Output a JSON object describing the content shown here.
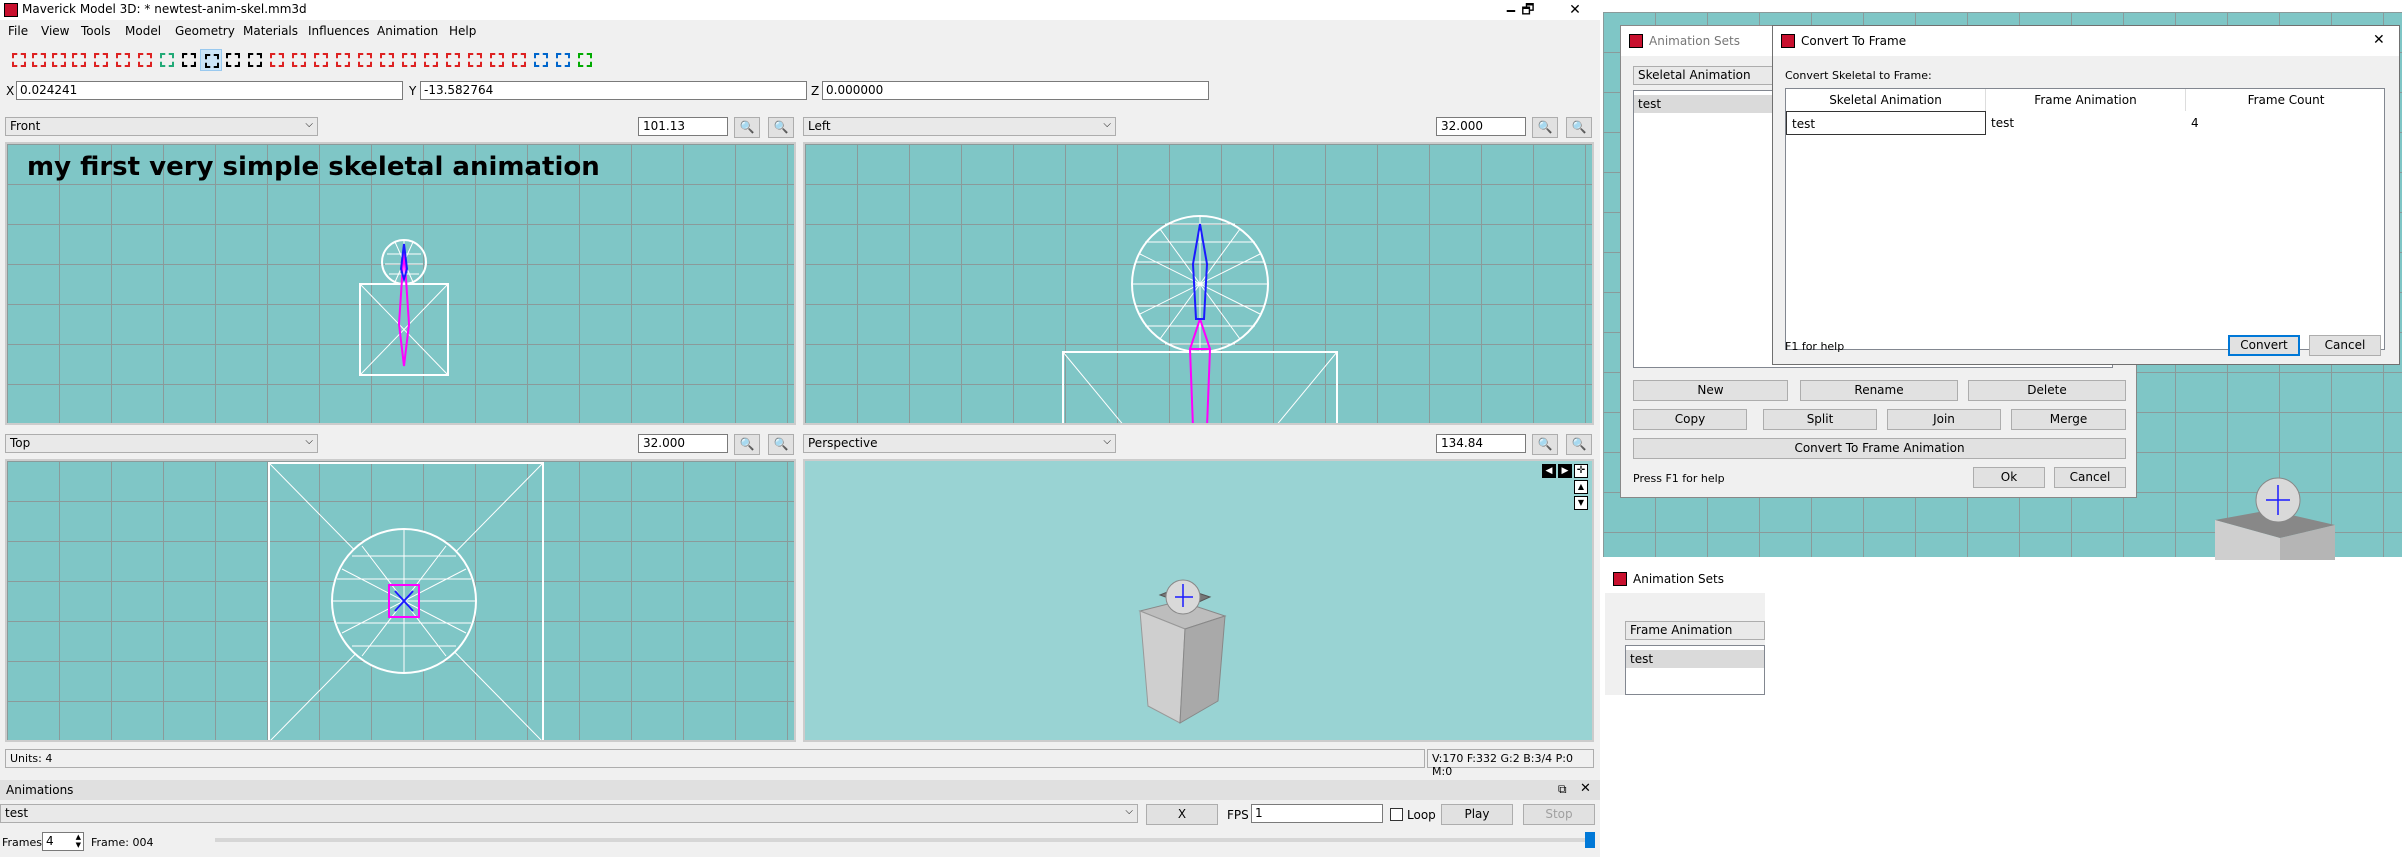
{
  "app": {
    "title": "Maverick Model 3D: * newtest-anim-skel.mm3d",
    "window_controls": [
      "🗕",
      "🗗",
      "✕"
    ]
  },
  "menu": [
    "File",
    "View",
    "Tools",
    "Model",
    "Geometry",
    "Materials",
    "Influences",
    "Animation",
    "Help"
  ],
  "toolbar": {
    "tools": [
      "select-vertices-icon",
      "select-faces-icon",
      "select-connected-icon",
      "select-groups-icon",
      "select-bone-joints-icon",
      "select-points-icon",
      "select-projections-icon",
      "attach-texture-icon",
      "move-icon",
      "rotate-icon",
      "scale-icon",
      "shear-icon",
      "create-vertex-icon",
      "create-bone-joint-icon",
      "create-point-icon",
      "create-projection-icon",
      "create-rectangle-icon",
      "create-cube-icon",
      "create-ellipsoid-icon",
      "create-cylinder-icon",
      "create-torus-icon",
      "create-polygon-icon",
      "background-grid-icon",
      "pan-icon",
      "view-icon",
      "extrude-icon",
      "cylinder-icon"
    ],
    "selected_index": 9
  },
  "coords": {
    "x_label": "X",
    "x_value": "0.024241",
    "y_label": "Y",
    "y_value": "-13.582764",
    "z_label": "Z",
    "z_value": "0.000000"
  },
  "viewports": {
    "front": {
      "view": "Front",
      "zoom": "101.13",
      "caption": "my first very simple skeletal animation"
    },
    "left": {
      "view": "Left",
      "zoom": "32.000"
    },
    "top": {
      "view": "Top",
      "zoom": "32.000"
    },
    "perspective": {
      "view": "Perspective",
      "zoom": "134.84"
    }
  },
  "status": {
    "units": "Units: 4",
    "stats": "V:170 F:332 G:2 B:3/4 P:0 M:0"
  },
  "animations_panel": {
    "title": "Animations",
    "selected_animation": "test",
    "x_button": "X",
    "fps_label": "FPS",
    "fps_value": "1",
    "loop_label": "Loop",
    "play_label": "Play",
    "stop_label": "Stop",
    "frames_label": "Frames",
    "frames_value": "4",
    "frame_text": "Frame: 004",
    "frame_position": 1.0
  },
  "animation_sets_dialog": {
    "title": "Animation Sets",
    "type_value": "Skeletal Animation",
    "items": [
      "test"
    ],
    "buttons": {
      "new": "New",
      "rename": "Rename",
      "delete": "Delete",
      "copy": "Copy",
      "split": "Split",
      "join": "Join",
      "merge": "Merge",
      "convert": "Convert To Frame Animation",
      "ok": "Ok",
      "cancel": "Cancel"
    },
    "help": "Press F1 for help"
  },
  "convert_dialog": {
    "title": "Convert To Frame",
    "label": "Convert Skeletal to Frame:",
    "columns": [
      "Skeletal Animation",
      "Frame Animation",
      "Frame Count"
    ],
    "rows": [
      {
        "skeletal": "test",
        "frame": "test",
        "count": "4"
      }
    ],
    "help": "F1 for help",
    "convert_button": "Convert",
    "cancel_button": "Cancel"
  },
  "animation_sets_dialog_2": {
    "title": "Animation Sets",
    "type_value": "Frame Animation",
    "items": [
      "test"
    ]
  },
  "colors": {
    "viewport_bg": "#7fc6c6",
    "mesh": "#ffffff",
    "bone": "#1a1aff",
    "bone_selected": "#ff00ff",
    "accent": "#0078d7"
  }
}
